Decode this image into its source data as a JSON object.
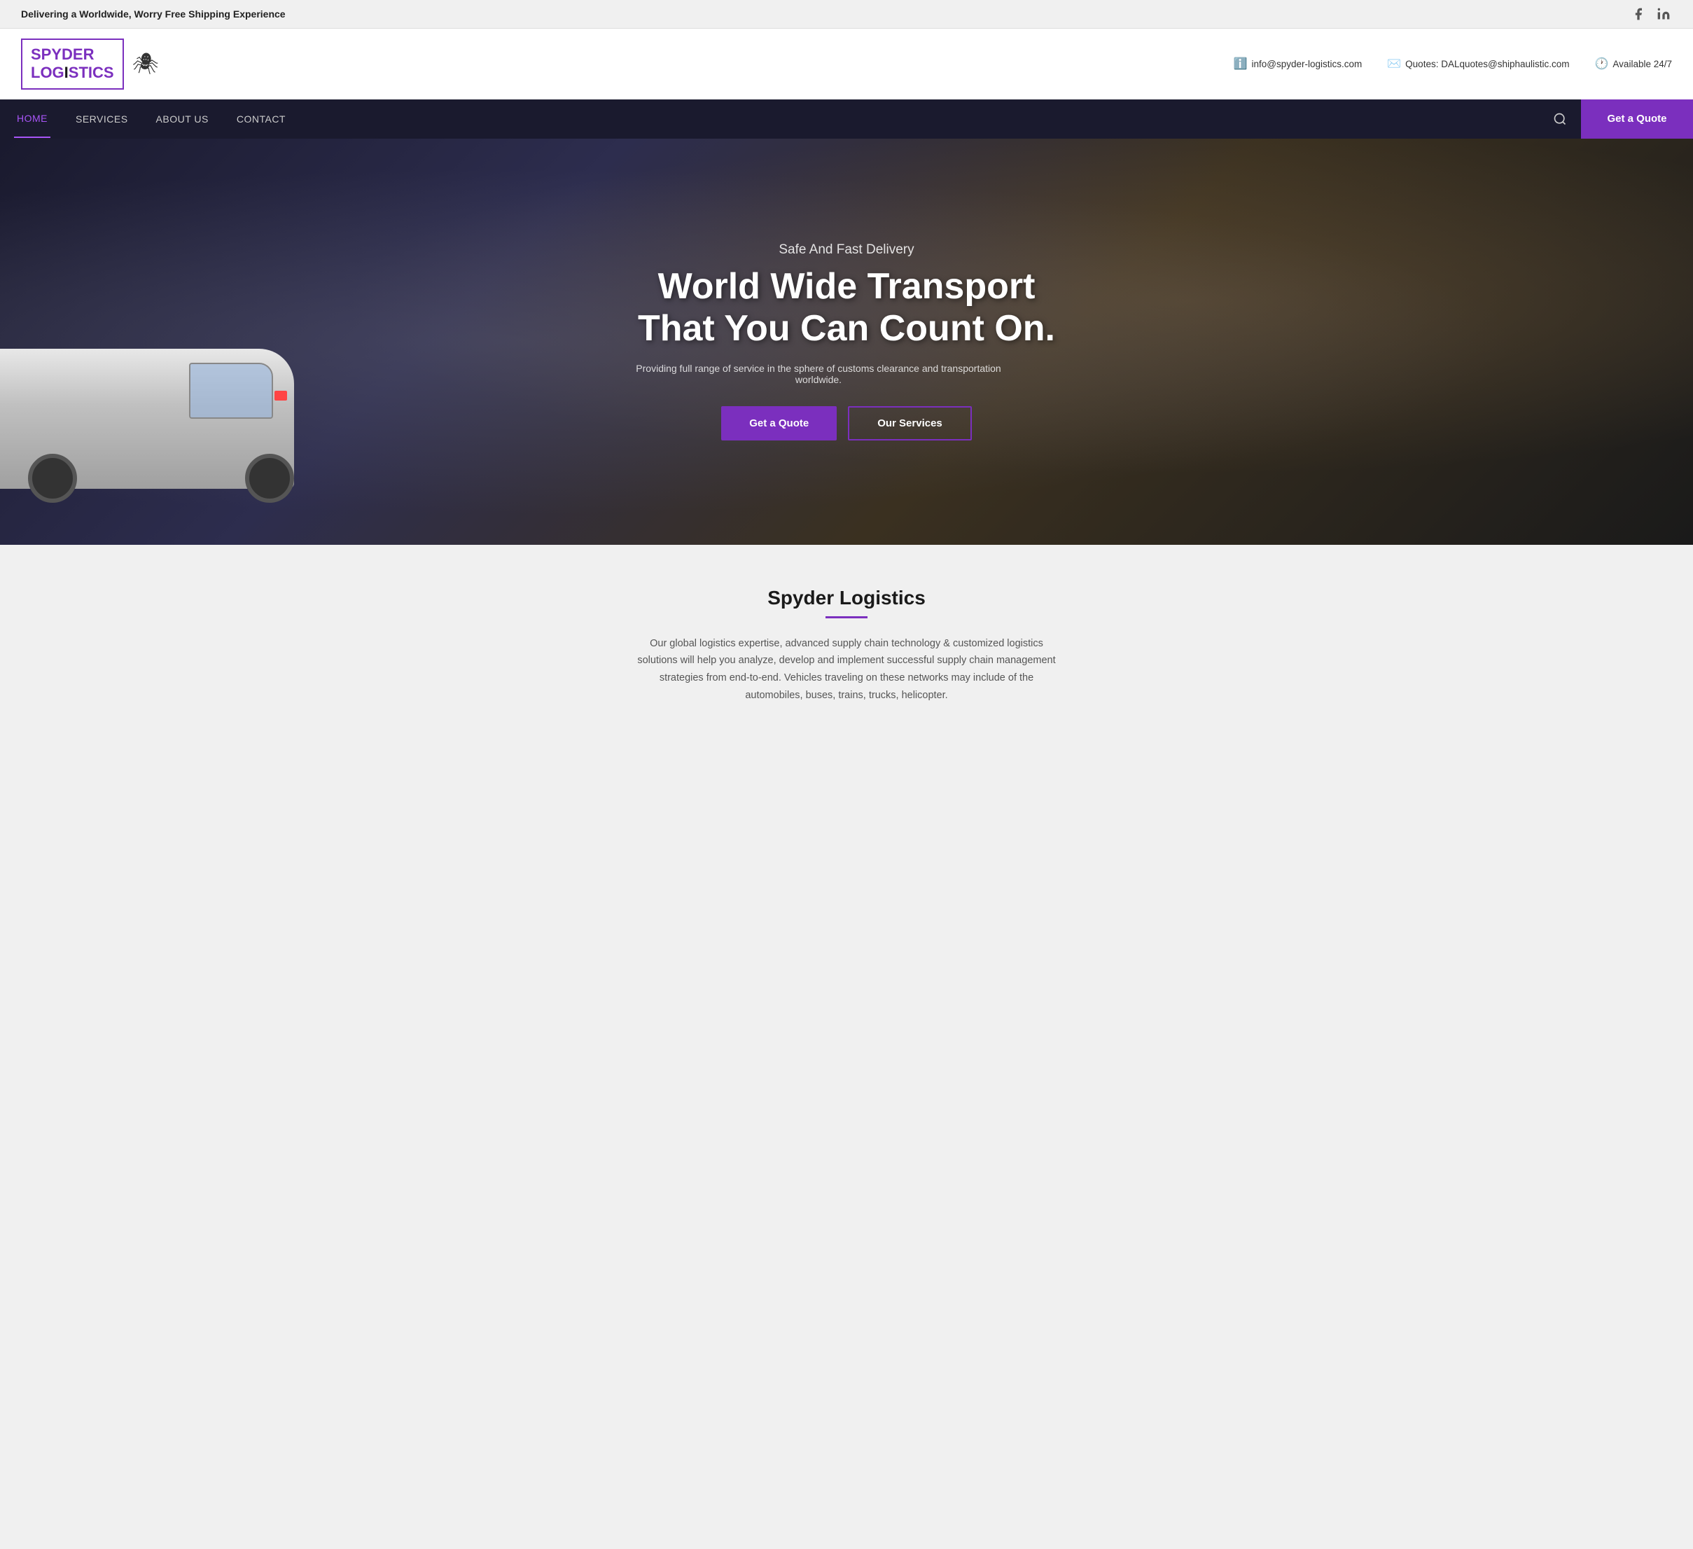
{
  "topBanner": {
    "text": "Delivering a Worldwide, Worry Free Shipping Experience",
    "social": [
      {
        "name": "facebook",
        "symbol": "f"
      },
      {
        "name": "linkedin",
        "symbol": "in"
      }
    ]
  },
  "header": {
    "logoLine1": "SPYDER",
    "logoLine2": "LOG STICS",
    "contacts": [
      {
        "type": "info",
        "icon": "ℹ",
        "text": "info@spyder-logistics.com"
      },
      {
        "type": "email",
        "icon": "✉",
        "text": "Quotes: DALquotes@shiphaulistic.com"
      },
      {
        "type": "clock",
        "icon": "🕐",
        "text": "Available 24/7"
      }
    ]
  },
  "nav": {
    "items": [
      {
        "label": "HOME",
        "active": true
      },
      {
        "label": "SERVICES",
        "active": false
      },
      {
        "label": "ABOUT US",
        "active": false
      },
      {
        "label": "CONTACT",
        "active": false
      }
    ],
    "quoteLabel": "Get a Quote"
  },
  "hero": {
    "subtitle": "Safe And Fast Delivery",
    "title": "World Wide Transport That You Can Count On.",
    "description": "Providing full range of service in the sphere of customs clearance and transportation worldwide.",
    "btn_quote": "Get a Quote",
    "btn_services": "Our Services"
  },
  "about": {
    "title": "Spyder Logistics",
    "text": "Our global logistics expertise, advanced supply chain technology & customized logistics solutions will help you analyze, develop and implement successful supply chain management strategies from end-to-end. Vehicles traveling on these networks may include of the automobiles, buses, trains, trucks, helicopter."
  }
}
